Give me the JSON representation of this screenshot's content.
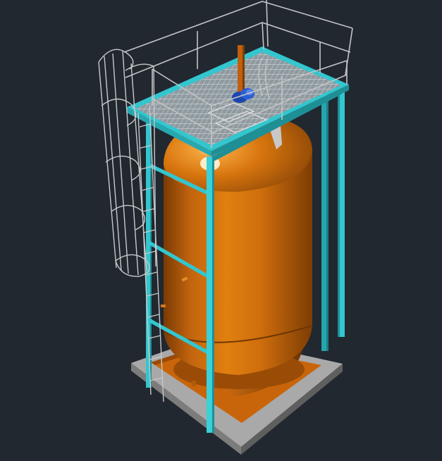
{
  "viewport": {
    "background_color": "#212830",
    "visual_style": "realistic-3d"
  },
  "model": {
    "tank_color": "#c8650f",
    "frame_color": "#33c6cf",
    "base_slab_color": "#a9a9a9",
    "base_pad_color": "#c8650a",
    "rail_color": "#c4c4c4",
    "grating_color": "#bfc4c6",
    "motor_color": "#2a5fd6",
    "shaft_color": "#c0600f"
  }
}
